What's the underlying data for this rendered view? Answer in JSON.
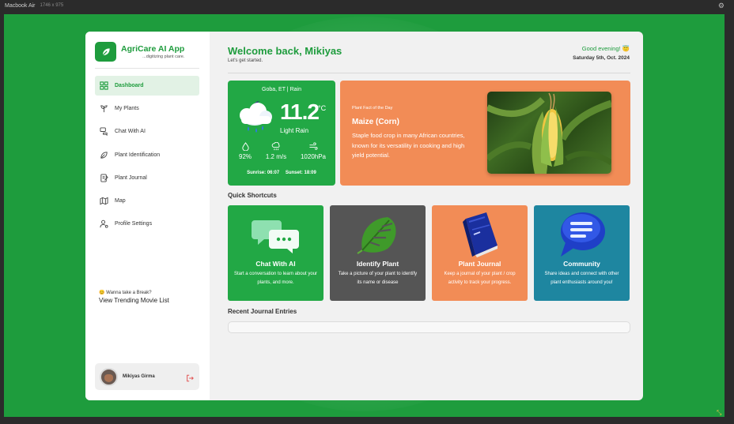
{
  "window": {
    "title": "Macbook Air",
    "dims": "1746 x 975"
  },
  "brand": {
    "title": "AgriCare AI App",
    "tagline": "...digitizing plant care."
  },
  "sidebar": {
    "items": [
      {
        "label": "Dashboard",
        "icon": "dashboard-icon",
        "active": true
      },
      {
        "label": "My Plants",
        "icon": "sprout-icon"
      },
      {
        "label": "Chat With AI",
        "icon": "chat-icon"
      },
      {
        "label": "Plant Identification",
        "icon": "leaf-icon"
      },
      {
        "label": "Plant Journal",
        "icon": "journal-icon"
      },
      {
        "label": "Map",
        "icon": "map-icon"
      },
      {
        "label": "Profile Settings",
        "icon": "user-settings-icon"
      }
    ],
    "break_question": "😊 Wanna take a Break?",
    "break_link": "View Trending Movie List",
    "user_name": "Mikiyas Girma"
  },
  "header": {
    "welcome": "Welcome back, Mikiyas",
    "subtitle": "Let's get started.",
    "greeting": "Good evening! 😇",
    "date": "Saturday 5th, Oct. 2024"
  },
  "weather": {
    "location": "Goba, ET | Rain",
    "temp": "11.2",
    "unit": "°C",
    "condition": "Light Rain",
    "humidity": "92%",
    "wind": "1.2 m/s",
    "pressure": "1020hPa",
    "sunrise": "Sunrise: 06:07",
    "sunset": "Sunset: 18:09"
  },
  "fact": {
    "label": "Plant Fact of the Day",
    "name": "Maize (Corn)",
    "description": "Staple food crop in many African countries, known for its versatility in cooking and high yield potential."
  },
  "shortcuts": {
    "title": "Quick Shortcuts",
    "items": [
      {
        "title": "Chat With AI",
        "desc": "Start a conversation to learn about your plants, and more."
      },
      {
        "title": "Identify Plant",
        "desc": "Take a picture of your plant to identify its name or disease"
      },
      {
        "title": "Plant Journal",
        "desc": "Keep a journal of your plant / crop activity to track your progress."
      },
      {
        "title": "Community",
        "desc": "Share ideas and connect with other plant enthusiasts around you!"
      }
    ]
  },
  "journal": {
    "title": "Recent Journal Entries"
  },
  "colors": {
    "brand_green": "#1e9c3d",
    "card_green": "#22a845",
    "orange": "#f28c56",
    "gray": "#555555",
    "teal": "#1e86a0"
  }
}
